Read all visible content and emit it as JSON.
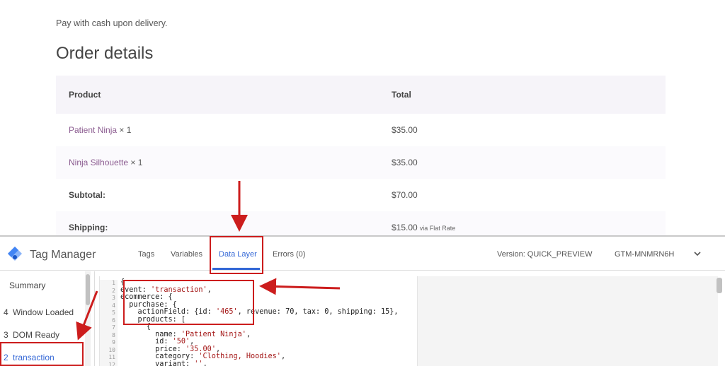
{
  "order": {
    "payment_note": "Pay with cash upon delivery.",
    "title": "Order details",
    "headers": {
      "product": "Product",
      "total": "Total"
    },
    "items": [
      {
        "name": "Patient Ninja",
        "qty": "× 1",
        "total": "$35.00"
      },
      {
        "name": "Ninja Silhouette",
        "qty": "× 1",
        "total": "$35.00"
      }
    ],
    "subtotal": {
      "label": "Subtotal:",
      "value": "$70.00"
    },
    "shipping": {
      "label": "Shipping:",
      "value": "$15.00",
      "via": "via Flat Rate"
    }
  },
  "gtm": {
    "brand": "Tag Manager",
    "tabs": [
      "Tags",
      "Variables",
      "Data Layer",
      "Errors (0)"
    ],
    "version": "Version: QUICK_PREVIEW",
    "container_id": "GTM-MNMRN6H",
    "sidebar": {
      "summary": "Summary",
      "events": [
        {
          "num": "4",
          "label": "Window Loaded"
        },
        {
          "num": "3",
          "label": "DOM Ready"
        },
        {
          "num": "2",
          "label": "transaction"
        }
      ]
    },
    "code_line_numbers": [
      "1",
      "2",
      "3",
      "4",
      "5",
      "6",
      "7",
      "8",
      "9",
      "10",
      "11",
      "12"
    ],
    "code": {
      "l1": "{",
      "l2_key": "event: ",
      "l2_str": "'transaction'",
      "l2_end": ",",
      "l3": "ecommerce: {",
      "l4": "  purchase: {",
      "l5_a": "    actionField: {id: ",
      "l5_str": "'465'",
      "l5_b": ", revenue: 70, tax: 0, shipping: 15},",
      "l6": "    products: [",
      "l7": "      {",
      "l8_key": "        name: ",
      "l8_str": "'Patient Ninja'",
      "l8_end": ",",
      "l9_key": "        id: ",
      "l9_str": "'50'",
      "l9_end": ",",
      "l10_key": "        price: ",
      "l10_str": "'35.00'",
      "l10_end": ",",
      "l11_key": "        category: ",
      "l11_str": "'Clothing, Hoodies'",
      "l11_end": ",",
      "l12_key": "        variant: ",
      "l12_str": "''",
      "l12_end": ","
    }
  },
  "colors": {
    "accent": "#3367d6",
    "annotation": "#cc1d1d",
    "link": "#8a5a8f"
  }
}
